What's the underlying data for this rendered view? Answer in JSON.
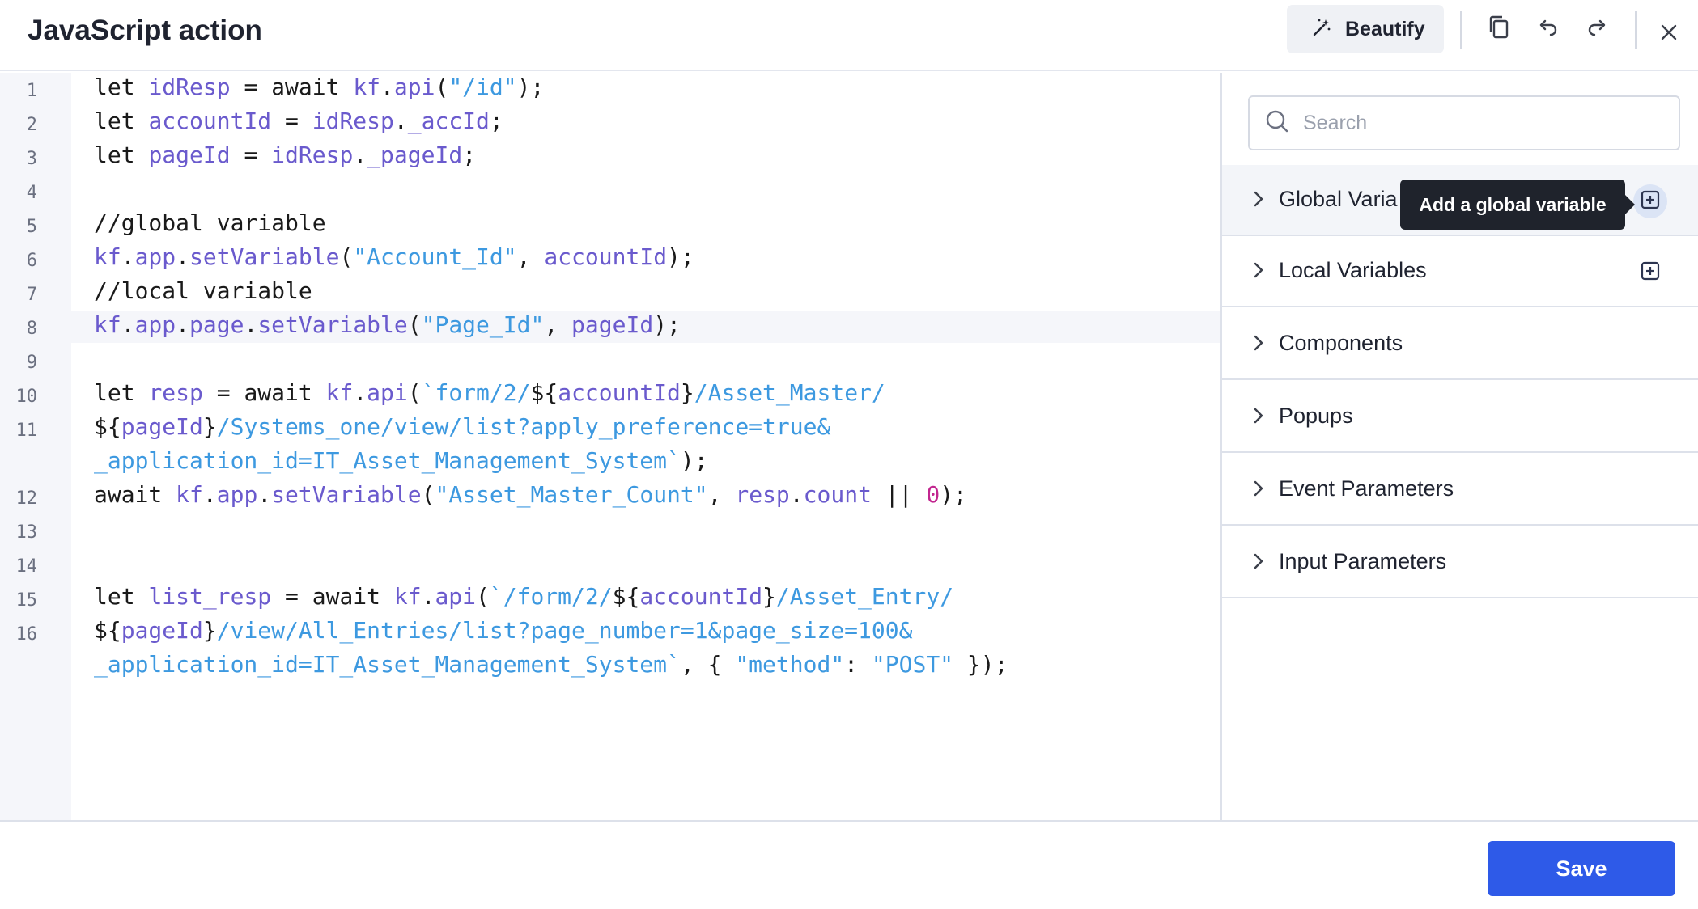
{
  "header": {
    "title": "JavaScript action",
    "beautify_label": "Beautify",
    "icons": [
      "magic-wand-icon",
      "copy-icon",
      "undo-icon",
      "redo-icon",
      "close-icon"
    ]
  },
  "editor": {
    "line_numbers": [
      "1",
      "2",
      "3",
      "4",
      "5",
      "6",
      "7",
      "8",
      "9",
      "10",
      "11",
      "12",
      "13",
      "14",
      "15",
      "16"
    ],
    "lines": [
      [
        {
          "t": "let ",
          "c": "kw"
        },
        {
          "t": "idResp",
          "c": "var"
        },
        {
          "t": " = await ",
          "c": "kw"
        },
        {
          "t": "kf",
          "c": "var"
        },
        {
          "t": ".",
          "c": "kw"
        },
        {
          "t": "api",
          "c": "var"
        },
        {
          "t": "(",
          "c": "kw"
        },
        {
          "t": "\"/id\"",
          "c": "str"
        },
        {
          "t": ");",
          "c": "kw"
        }
      ],
      [
        {
          "t": "let ",
          "c": "kw"
        },
        {
          "t": "accountId",
          "c": "var"
        },
        {
          "t": " = ",
          "c": "kw"
        },
        {
          "t": "idResp",
          "c": "var"
        },
        {
          "t": ".",
          "c": "kw"
        },
        {
          "t": "_accId",
          "c": "var"
        },
        {
          "t": ";",
          "c": "kw"
        }
      ],
      [
        {
          "t": "let ",
          "c": "kw"
        },
        {
          "t": "pageId",
          "c": "var"
        },
        {
          "t": " = ",
          "c": "kw"
        },
        {
          "t": "idResp",
          "c": "var"
        },
        {
          "t": ".",
          "c": "kw"
        },
        {
          "t": "_pageId",
          "c": "var"
        },
        {
          "t": ";",
          "c": "kw"
        }
      ],
      [],
      [
        {
          "t": "//global variable",
          "c": "cmt"
        }
      ],
      [
        {
          "t": "kf",
          "c": "var"
        },
        {
          "t": ".",
          "c": "kw"
        },
        {
          "t": "app",
          "c": "var"
        },
        {
          "t": ".",
          "c": "kw"
        },
        {
          "t": "setVariable",
          "c": "var"
        },
        {
          "t": "(",
          "c": "kw"
        },
        {
          "t": "\"Account_Id\"",
          "c": "str"
        },
        {
          "t": ", ",
          "c": "kw"
        },
        {
          "t": "accountId",
          "c": "var"
        },
        {
          "t": ");",
          "c": "kw"
        }
      ],
      [
        {
          "t": "//local variable",
          "c": "cmt"
        }
      ],
      [
        {
          "t": "kf",
          "c": "var"
        },
        {
          "t": ".",
          "c": "kw"
        },
        {
          "t": "app",
          "c": "var"
        },
        {
          "t": ".",
          "c": "kw"
        },
        {
          "t": "page",
          "c": "var"
        },
        {
          "t": ".",
          "c": "kw"
        },
        {
          "t": "setVariable",
          "c": "var"
        },
        {
          "t": "(",
          "c": "kw"
        },
        {
          "t": "\"Page_Id\"",
          "c": "str"
        },
        {
          "t": ", ",
          "c": "kw"
        },
        {
          "t": "pageId",
          "c": "var"
        },
        {
          "t": ");",
          "c": "kw"
        }
      ],
      [],
      [
        {
          "t": "let ",
          "c": "kw"
        },
        {
          "t": "resp",
          "c": "var"
        },
        {
          "t": " = await ",
          "c": "kw"
        },
        {
          "t": "kf",
          "c": "var"
        },
        {
          "t": ".",
          "c": "kw"
        },
        {
          "t": "api",
          "c": "var"
        },
        {
          "t": "(",
          "c": "kw"
        },
        {
          "t": "`form/2/",
          "c": "str"
        },
        {
          "t": "${",
          "c": "kw"
        },
        {
          "t": "accountId",
          "c": "var"
        },
        {
          "t": "}",
          "c": "kw"
        },
        {
          "t": "/Asset_Master/",
          "c": "str"
        }
      ],
      [
        {
          "t": "${",
          "c": "kw"
        },
        {
          "t": "pageId",
          "c": "var"
        },
        {
          "t": "}",
          "c": "kw"
        },
        {
          "t": "/Systems_one/view/list?apply_preference=true&",
          "c": "str"
        }
      ],
      [
        {
          "t": "_application_id=IT_Asset_Management_System`",
          "c": "str"
        },
        {
          "t": ");",
          "c": "kw"
        }
      ],
      [
        {
          "t": "await ",
          "c": "kw"
        },
        {
          "t": "kf",
          "c": "var"
        },
        {
          "t": ".",
          "c": "kw"
        },
        {
          "t": "app",
          "c": "var"
        },
        {
          "t": ".",
          "c": "kw"
        },
        {
          "t": "setVariable",
          "c": "var"
        },
        {
          "t": "(",
          "c": "kw"
        },
        {
          "t": "\"Asset_Master_Count\"",
          "c": "str"
        },
        {
          "t": ", ",
          "c": "kw"
        },
        {
          "t": "resp",
          "c": "var"
        },
        {
          "t": ".",
          "c": "kw"
        },
        {
          "t": "count",
          "c": "var"
        },
        {
          "t": " || ",
          "c": "kw"
        },
        {
          "t": "0",
          "c": "num"
        },
        {
          "t": ");",
          "c": "kw"
        }
      ],
      [],
      [],
      [
        {
          "t": "let ",
          "c": "kw"
        },
        {
          "t": "list_resp",
          "c": "var"
        },
        {
          "t": " = await ",
          "c": "kw"
        },
        {
          "t": "kf",
          "c": "var"
        },
        {
          "t": ".",
          "c": "kw"
        },
        {
          "t": "api",
          "c": "var"
        },
        {
          "t": "(",
          "c": "kw"
        },
        {
          "t": "`/form/2/",
          "c": "str"
        },
        {
          "t": "${",
          "c": "kw"
        },
        {
          "t": "accountId",
          "c": "var"
        },
        {
          "t": "}",
          "c": "kw"
        },
        {
          "t": "/Asset_Entry/",
          "c": "str"
        }
      ],
      [
        {
          "t": "${",
          "c": "kw"
        },
        {
          "t": "pageId",
          "c": "var"
        },
        {
          "t": "}",
          "c": "kw"
        },
        {
          "t": "/view/All_Entries/list?page_number=1&page_size=100&",
          "c": "str"
        }
      ],
      [
        {
          "t": "_application_id=IT_Asset_Management_System`",
          "c": "str"
        },
        {
          "t": ", { ",
          "c": "kw"
        },
        {
          "t": "\"method\"",
          "c": "str"
        },
        {
          "t": ": ",
          "c": "kw"
        },
        {
          "t": "\"POST\"",
          "c": "str"
        },
        {
          "t": " });",
          "c": "kw"
        }
      ]
    ]
  },
  "sidebar": {
    "search_placeholder": "Search",
    "sections": [
      {
        "label": "Global Varia",
        "has_add": true
      },
      {
        "label": "Local Variables",
        "has_add": true
      },
      {
        "label": "Components",
        "has_add": false
      },
      {
        "label": "Popups",
        "has_add": false
      },
      {
        "label": "Event Parameters",
        "has_add": false
      },
      {
        "label": "Input Parameters",
        "has_add": false
      }
    ],
    "tooltip": "Add a global variable"
  },
  "footer": {
    "save_label": "Save"
  },
  "colors": {
    "accent": "#2e5ae8",
    "code_variable": "#6a5acd",
    "code_string": "#3d99e0",
    "code_number": "#c2258f"
  }
}
